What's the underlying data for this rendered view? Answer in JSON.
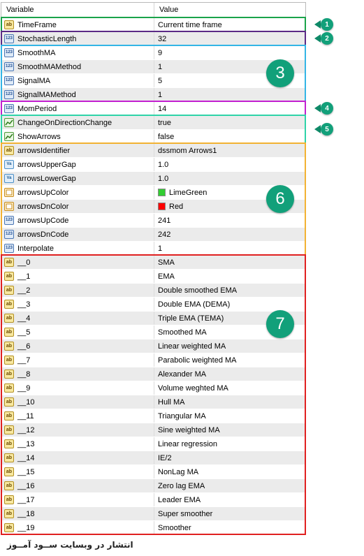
{
  "header": {
    "col_variable": "Variable",
    "col_value": "Value"
  },
  "rows": [
    {
      "name": "TimeFrame",
      "value": "Current time frame",
      "icon": "ab"
    },
    {
      "name": "StochasticLength",
      "value": "32",
      "icon": "num"
    },
    {
      "name": "SmoothMA",
      "value": "9",
      "icon": "num"
    },
    {
      "name": "SmoothMAMethod",
      "value": "1",
      "icon": "num"
    },
    {
      "name": "SignalMA",
      "value": "5",
      "icon": "num"
    },
    {
      "name": "SignalMAMethod",
      "value": "1",
      "icon": "num"
    },
    {
      "name": "MomPeriod",
      "value": "14",
      "icon": "num"
    },
    {
      "name": "ChangeOnDirectionChange",
      "value": "true",
      "icon": "bool"
    },
    {
      "name": "ShowArrows",
      "value": "false",
      "icon": "bool"
    },
    {
      "name": "arrowsIdentifier",
      "value": "dssmom Arrows1",
      "icon": "ab"
    },
    {
      "name": "arrowsUpperGap",
      "value": "1.0",
      "icon": "dbl"
    },
    {
      "name": "arrowsLowerGap",
      "value": "1.0",
      "icon": "dbl"
    },
    {
      "name": "arrowsUpColor",
      "value": "LimeGreen",
      "icon": "col",
      "swatch": "#32cd32"
    },
    {
      "name": "arrowsDnColor",
      "value": "Red",
      "icon": "col",
      "swatch": "#ff0000"
    },
    {
      "name": "arrowsUpCode",
      "value": "241",
      "icon": "num"
    },
    {
      "name": "arrowsDnCode",
      "value": "242",
      "icon": "num"
    },
    {
      "name": "Interpolate",
      "value": "1",
      "icon": "num"
    },
    {
      "name": "__0",
      "value": "SMA",
      "icon": "ab"
    },
    {
      "name": "__1",
      "value": "EMA",
      "icon": "ab"
    },
    {
      "name": "__2",
      "value": "Double smoothed EMA",
      "icon": "ab"
    },
    {
      "name": "__3",
      "value": "Double EMA (DEMA)",
      "icon": "ab"
    },
    {
      "name": "__4",
      "value": "Triple EMA (TEMA)",
      "icon": "ab"
    },
    {
      "name": "__5",
      "value": "Smoothed MA",
      "icon": "ab"
    },
    {
      "name": "__6",
      "value": "Linear weighted MA",
      "icon": "ab"
    },
    {
      "name": "__7",
      "value": "Parabolic weighted MA",
      "icon": "ab"
    },
    {
      "name": "__8",
      "value": "Alexander MA",
      "icon": "ab"
    },
    {
      "name": "__9",
      "value": "Volume weghted MA",
      "icon": "ab"
    },
    {
      "name": "__10",
      "value": "Hull MA",
      "icon": "ab"
    },
    {
      "name": "__11",
      "value": "Triangular MA",
      "icon": "ab"
    },
    {
      "name": "__12",
      "value": "Sine weighted MA",
      "icon": "ab"
    },
    {
      "name": "__13",
      "value": "Linear regression",
      "icon": "ab"
    },
    {
      "name": "__14",
      "value": "IE/2",
      "icon": "ab"
    },
    {
      "name": "__15",
      "value": "NonLag MA",
      "icon": "ab"
    },
    {
      "name": "__16",
      "value": "Zero lag EMA",
      "icon": "ab"
    },
    {
      "name": "__17",
      "value": "Leader EMA",
      "icon": "ab"
    },
    {
      "name": "__18",
      "value": "Super smoother",
      "icon": "ab"
    },
    {
      "name": "__19",
      "value": "Smoother",
      "icon": "ab"
    }
  ],
  "icon_labels": {
    "ab": "ab",
    "num": "123",
    "dbl": "Va",
    "bool": "",
    "col": ""
  },
  "groups": [
    {
      "label": "1",
      "color": "#1aa34a",
      "first": 0,
      "last": 0,
      "badge": "small"
    },
    {
      "label": "2",
      "color": "#5b2a86",
      "first": 1,
      "last": 1,
      "badge": "small"
    },
    {
      "label": "3",
      "color": "#33b5e5",
      "first": 2,
      "last": 5,
      "badge": "big"
    },
    {
      "label": "4",
      "color": "#c31fd0",
      "first": 6,
      "last": 6,
      "badge": "small"
    },
    {
      "label": "5",
      "color": "#2ed3a8",
      "first": 7,
      "last": 8,
      "badge": "small"
    },
    {
      "label": "6",
      "color": "#f2b233",
      "first": 9,
      "last": 16,
      "badge": "big"
    },
    {
      "label": "7",
      "color": "#e02020",
      "first": 17,
      "last": 36,
      "badge": "big"
    }
  ],
  "footer": "انتشار در وبسایت ســود آمــوز"
}
